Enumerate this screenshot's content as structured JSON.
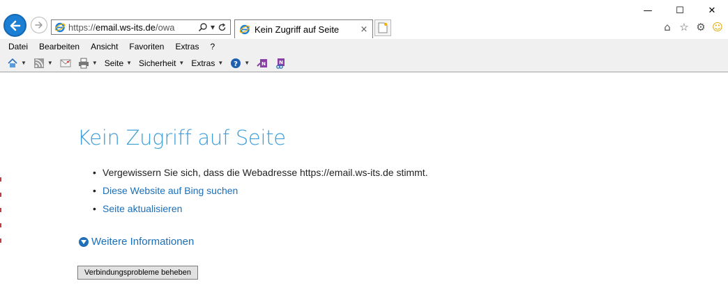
{
  "browser": {
    "address_url_prefix": "https://",
    "address_url_host": "email.ws-its.de",
    "address_url_path": "/owa",
    "tab_title": "Kein Zugriff auf Seite",
    "tab_close": "×",
    "window_controls": {
      "minimize": "—",
      "maximize": "☐",
      "close": "✕"
    }
  },
  "menubar": {
    "items": [
      "Datei",
      "Bearbeiten",
      "Ansicht",
      "Favoriten",
      "Extras",
      "?"
    ]
  },
  "commandbar": {
    "seite_label": "Seite",
    "sicherheit_label": "Sicherheit",
    "extras_label": "Extras"
  },
  "page": {
    "title": "Kein Zugriff auf Seite",
    "bullets": [
      "Vergewissern Sie sich, dass die Webadresse https://email.ws-its.de stimmt.",
      "Diese Website auf Bing suchen",
      "Seite aktualisieren"
    ],
    "more_info": "Weitere Informationen",
    "fix_button": "Verbindungsprobleme beheben"
  },
  "colors": {
    "accent_blue": "#3c9ed8",
    "link_blue": "#1a6fb9",
    "back_button": "#1b7fd4"
  }
}
